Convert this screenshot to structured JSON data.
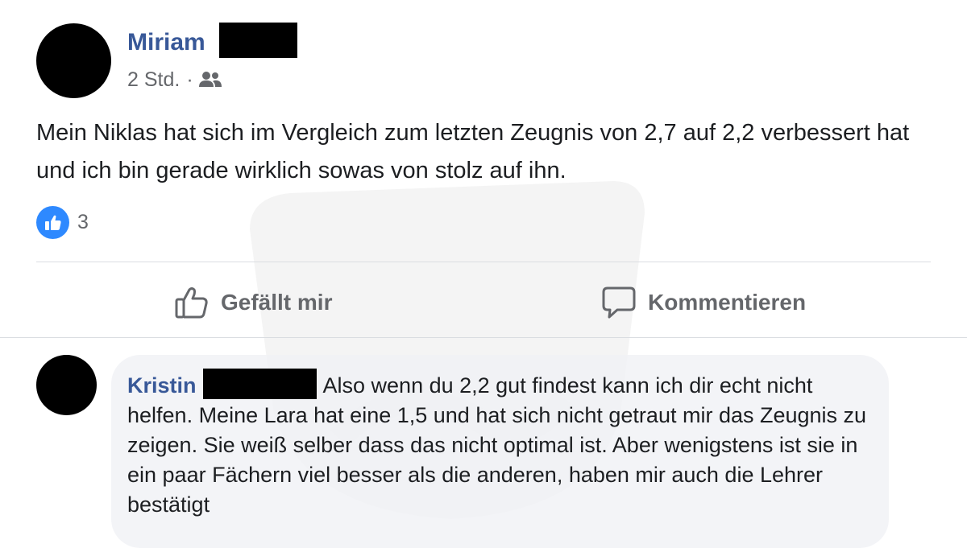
{
  "post": {
    "author": "Miriam",
    "time": "2 Std.",
    "separator": "·",
    "audience_icon": "friends-icon",
    "text": "Mein Niklas hat sich im Vergleich zum letzten Zeugnis von 2,7 auf 2,2 verbessert hat und ich bin gerade wirklich sowas von stolz auf ihn.",
    "reaction_icon": "like-icon",
    "reaction_count": "3"
  },
  "actions": {
    "like_label": "Gefällt mir",
    "like_icon": "thumbs-up-icon",
    "comment_label": "Kommentieren",
    "comment_icon": "speech-bubble-icon"
  },
  "comment": {
    "author": "Kristin",
    "text": "Also wenn du 2,2 gut findest kann ich dir echt nicht helfen. Meine Lara hat eine 1,5 und hat sich nicht getraut mir das Zeugnis zu zeigen. Sie weiß selber dass das nicht optimal ist. Aber wenigstens ist sie in ein paar Fächern viel besser als die anderen, haben mir auch die Lehrer bestätigt"
  },
  "colors": {
    "author_blue": "#385898",
    "meta_gray": "#65676b",
    "like_blue": "#2e89ff",
    "bubble_gray": "#f0f2f5"
  }
}
